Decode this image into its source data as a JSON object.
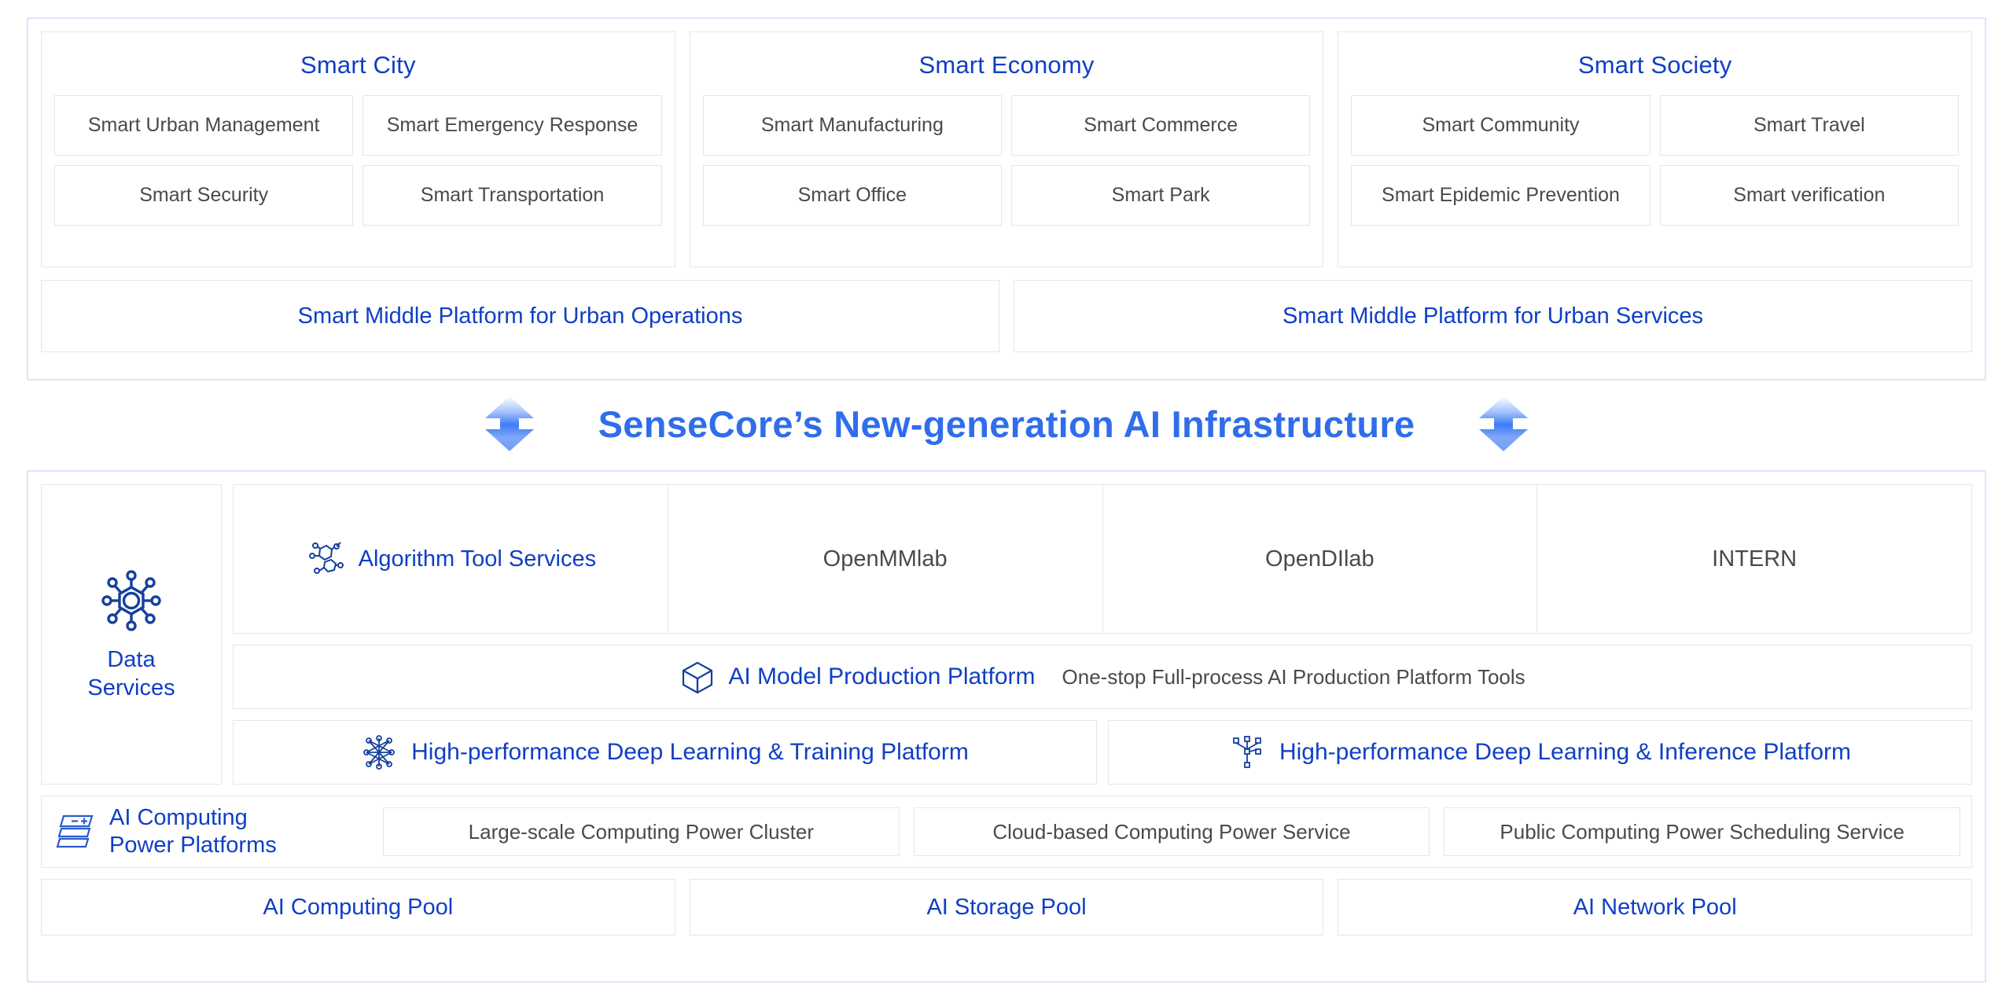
{
  "colors": {
    "brand_blue": "#0f3fc4",
    "title_blue": "#2f6dea",
    "body_gray": "#4a4a4a",
    "outer_border": "#dde5fa",
    "card_border": "#e6e6e6"
  },
  "top_section": {
    "domains": [
      {
        "title": "Smart City",
        "cells": [
          "Smart Urban Management",
          "Smart Emergency Response",
          "Smart Security",
          "Smart Transportation"
        ]
      },
      {
        "title": "Smart Economy",
        "cells": [
          "Smart Manufacturing",
          "Smart Commerce",
          "Smart Office",
          "Smart Park"
        ]
      },
      {
        "title": "Smart Society",
        "cells": [
          "Smart Community",
          "Smart Travel",
          "Smart Epidemic Prevention",
          "Smart verification"
        ]
      }
    ],
    "middle_platforms": [
      "Smart Middle Platform for Urban Operations",
      "Smart Middle Platform for Urban Services"
    ]
  },
  "center": {
    "title": "SenseCore’s New-generation AI Infrastructure",
    "left_icon": "up-down-arrow-icon",
    "right_icon": "up-down-arrow-icon"
  },
  "bottom_section": {
    "data_services": {
      "icon": "hexagon-network-icon",
      "line1": "Data",
      "line2": "Services"
    },
    "algorithm_row": [
      {
        "label": "Algorithm Tool Services",
        "icon": "molecule-icon",
        "highlight": true
      },
      {
        "label": "OpenMMlab",
        "icon": "",
        "highlight": false
      },
      {
        "label": "OpenDIlab",
        "icon": "",
        "highlight": false
      },
      {
        "label": "INTERN",
        "icon": "",
        "highlight": false
      }
    ],
    "model_platform": {
      "icon": "cube-icon",
      "title": "AI Model Production Platform",
      "subtitle": "One-stop Full-process AI Production Platform Tools"
    },
    "hp_platforms": [
      {
        "icon": "neural-net-icon",
        "label": "High-performance Deep Learning & Training Platform"
      },
      {
        "icon": "tree-node-icon",
        "label": "High-performance Deep Learning & Inference Platform"
      }
    ],
    "computing_power": {
      "icon": "server-stack-icon",
      "head_line1": "AI Computing",
      "head_line2": "Power Platforms",
      "cells": [
        "Large-scale Computing Power Cluster",
        "Cloud-based Computing Power Service",
        "Public Computing Power Scheduling Service"
      ]
    },
    "pools": [
      "AI Computing Pool",
      "AI Storage Pool",
      "AI Network Pool"
    ]
  }
}
